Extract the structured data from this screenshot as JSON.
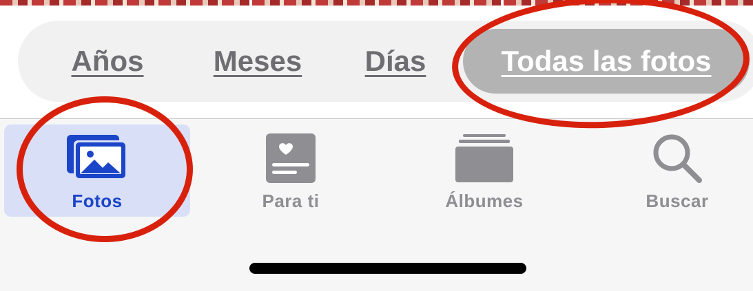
{
  "segmented_control": {
    "options": [
      {
        "label": "Años",
        "selected": false
      },
      {
        "label": "Meses",
        "selected": false
      },
      {
        "label": "Días",
        "selected": false
      },
      {
        "label": "Todas las fotos",
        "selected": true
      }
    ]
  },
  "tab_bar": {
    "items": [
      {
        "label": "Fotos",
        "icon": "photos-icon",
        "selected": true
      },
      {
        "label": "Para ti",
        "icon": "for-you-icon",
        "selected": false
      },
      {
        "label": "Álbumes",
        "icon": "albums-icon",
        "selected": false
      },
      {
        "label": "Buscar",
        "icon": "search-icon",
        "selected": false
      }
    ]
  },
  "colors": {
    "accent": "#1b45c9",
    "annotation": "#d8210c",
    "selected_segment": "#b3b3b3",
    "inactive": "#8e8e93"
  }
}
